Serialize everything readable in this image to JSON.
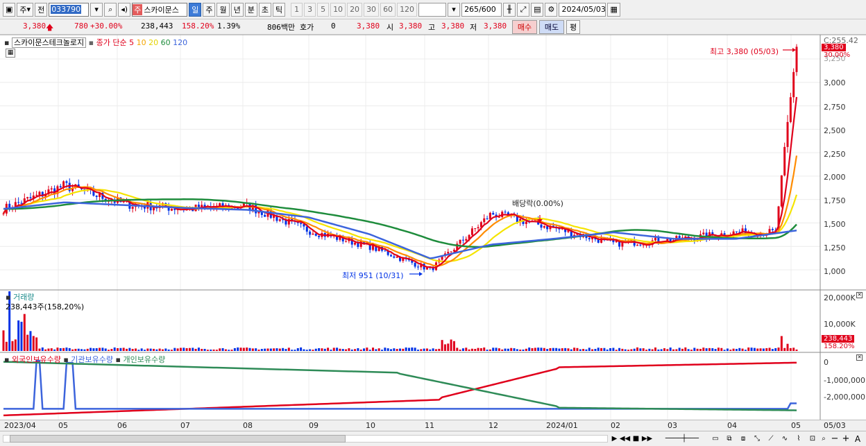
{
  "toolbar": {
    "market": "주",
    "prefix": "전",
    "code": "033790",
    "stock_tag": "주",
    "stock_name": "스카이문스",
    "periods": [
      "일",
      "주",
      "월",
      "년",
      "분",
      "초",
      "틱"
    ],
    "active_period": "일",
    "intervals": [
      "1",
      "3",
      "5",
      "10",
      "20",
      "30",
      "60",
      "120"
    ],
    "count": "265",
    "count_total": "/600",
    "date": "2024/05/03"
  },
  "quote": {
    "price": "3,380",
    "change": "780",
    "change_pct": "+30.00%",
    "volume": "238,443",
    "volume_pct": "158.20%",
    "turnover_pct": "1.39%",
    "amount": "806백만",
    "hoga_label": "호가",
    "hoga_value": "0",
    "bid_price": "3,380",
    "open_label": "시",
    "open": "3,380",
    "high_label": "고",
    "high": "3,380",
    "low_label": "저",
    "low": "3,380",
    "buy_label": "매수",
    "sell_label": "매도",
    "eval_label": "평"
  },
  "price_pane": {
    "name": "스카이문스테크놀로지",
    "ma_label": "종가 단순",
    "ma_periods": [
      "5",
      "10",
      "20",
      "60",
      "120"
    ],
    "high_note": "최고 3,380 (05/03)",
    "low_note": "최저 951 (10/31)",
    "dividend_note": "배당락(0.00%)",
    "current_tag": "3,380",
    "pct_tag": "30.00%",
    "top_tick": "C:255.42",
    "y_ticks": [
      "3,250",
      "3,000",
      "2,750",
      "2,500",
      "2,250",
      "2,000",
      "1,750",
      "1,500",
      "1,250",
      "1,000"
    ]
  },
  "volume_pane": {
    "title": "거래량",
    "value_note": "238,443주(158,20%)",
    "tag": "238,443",
    "pct_tag": "158.20%",
    "y_ticks": [
      "20,000K",
      "10,000K"
    ]
  },
  "holding_pane": {
    "series": [
      "외국인보유수량",
      "기관보유수량",
      "개인보유수량"
    ],
    "y_ticks": [
      "0",
      "-1,000,000",
      "-2,000,000"
    ]
  },
  "x_axis": {
    "labels": [
      "2023/04",
      "05",
      "06",
      "07",
      "08",
      "09",
      "10",
      "11",
      "12",
      "2024/01",
      "02",
      "03",
      "04",
      "05"
    ],
    "end_label": "05/03"
  },
  "colors": {
    "up": "#e0001b",
    "down": "#0032e6",
    "ma5": "#e0001b",
    "ma10": "#ff8c00",
    "ma20": "#f5e400",
    "ma60": "#1e8c3c",
    "ma120": "#3c64dc",
    "foreign": "#e0001b",
    "institution": "#3c64dc",
    "individual": "#2e8b57"
  },
  "chart_data": {
    "type": "line",
    "x": [
      "2023/04",
      "05",
      "06",
      "07",
      "08",
      "09",
      "10",
      "11",
      "12",
      "2024/01",
      "02",
      "03",
      "04",
      "05"
    ],
    "series": [
      {
        "values": [
          1650,
          1900,
          1700,
          1650,
          1680,
          1420,
          1250,
          1000,
          1600,
          1450,
          1280,
          1320,
          1400,
          3380
        ]
      },
      {
        "values": [
          1650,
          1720,
          1690,
          1660,
          1640,
          1560,
          1380,
          1120,
          1270,
          1330,
          1400,
          1330,
          1330,
          1420
        ]
      }
    ]
  }
}
